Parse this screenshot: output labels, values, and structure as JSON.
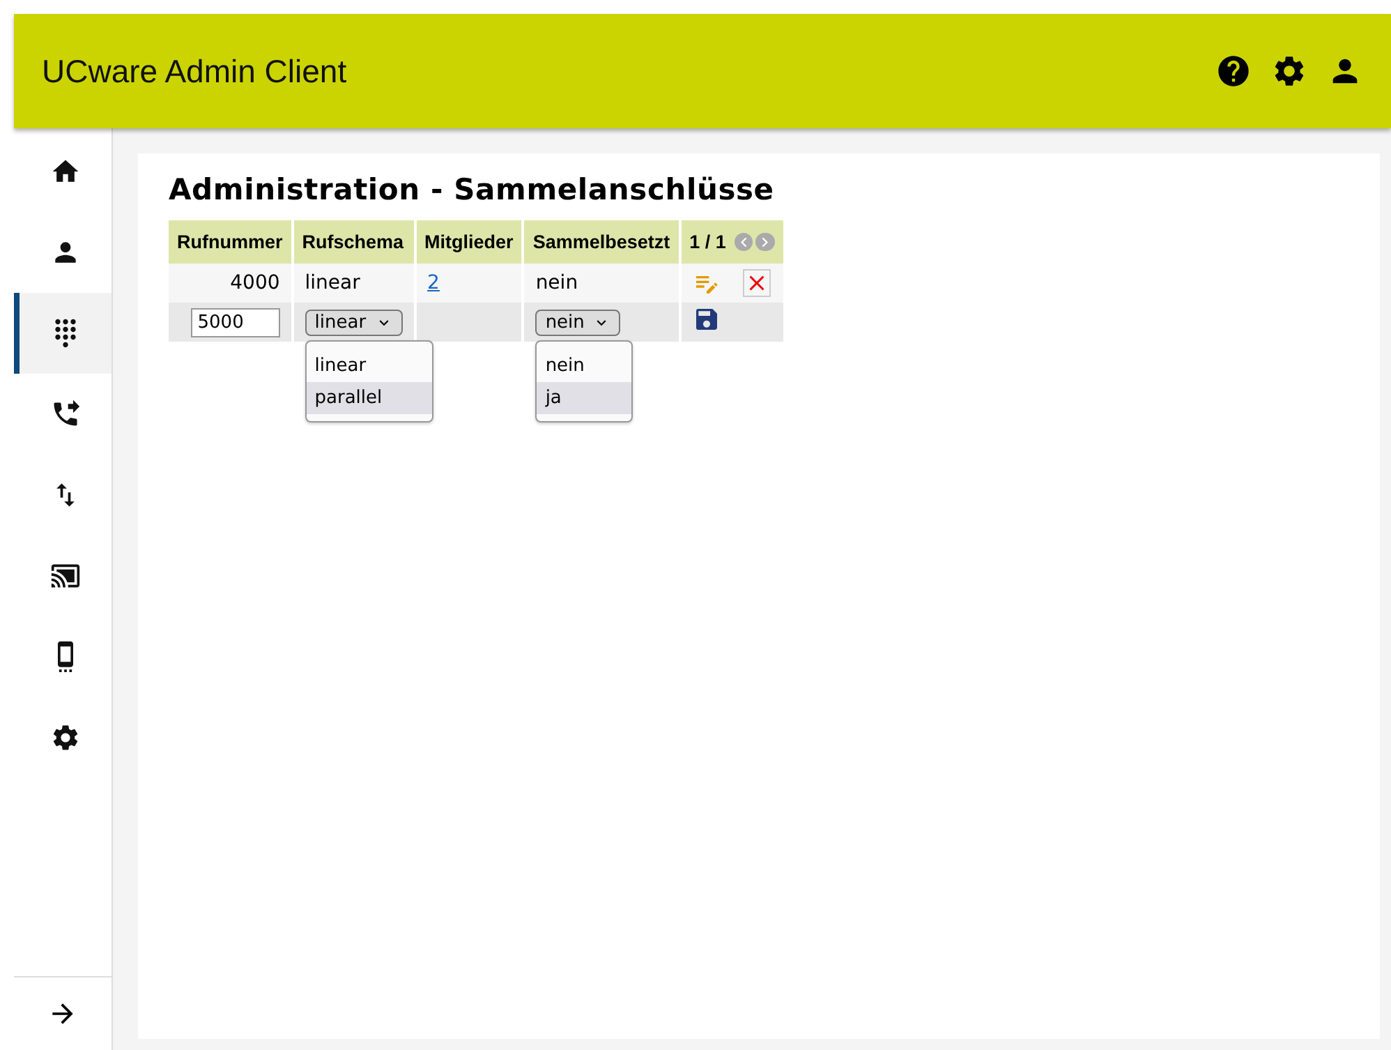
{
  "header": {
    "title": "UCware Admin Client"
  },
  "sidebar": {
    "items": [
      {
        "selected": false
      },
      {
        "selected": false
      },
      {
        "selected": true
      },
      {
        "selected": false
      },
      {
        "selected": false
      },
      {
        "selected": false
      },
      {
        "selected": false
      },
      {
        "selected": false
      }
    ]
  },
  "page": {
    "title": "Administration - Sammelanschlüsse"
  },
  "table": {
    "columns": [
      "Rufnummer",
      "Rufschema",
      "Mitglieder",
      "Sammelbesetzt"
    ],
    "pager": "1 / 1",
    "rows": [
      {
        "kind": "data",
        "number": "4000",
        "schema": "linear",
        "members": "2",
        "busy": "nein"
      },
      {
        "kind": "new",
        "number": "5000",
        "schema": {
          "value": "linear",
          "expanded": true,
          "options": [
            {
              "label": "linear",
              "hovered": false
            },
            {
              "label": "parallel",
              "hovered": true
            }
          ]
        },
        "busy": {
          "value": "nein",
          "expanded": true,
          "options": [
            {
              "label": "nein",
              "hovered": false
            },
            {
              "label": "ja",
              "hovered": true
            }
          ]
        }
      }
    ]
  }
}
